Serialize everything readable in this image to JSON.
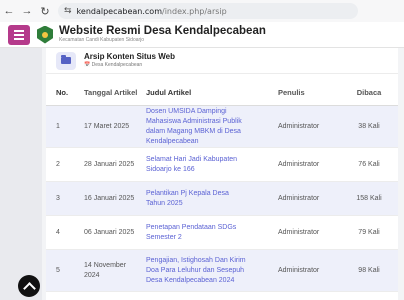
{
  "browser": {
    "back_icon": "←",
    "forward_icon": "→",
    "reload_icon": "↻",
    "tune_icon": "⇆",
    "url_host": "kendalpecabean.com",
    "url_path": "/index.php/arsip"
  },
  "site": {
    "title": "Website Resmi Desa Kendalpecabean",
    "subtitle": "Kecamatan Candi  Kabupaten Sidoarjo"
  },
  "card": {
    "title": "Arsip Konten Situs Web",
    "subtitle": "📅 Desa Kendalpecabean"
  },
  "table": {
    "headers": {
      "no": "No.",
      "date": "Tanggal Artikel",
      "title": "Judul Artikel",
      "author": "Penulis",
      "reads": "Dibaca"
    },
    "rows": [
      {
        "no": "1",
        "date": "17 Maret 2025",
        "title": "Dosen UMSIDA Dampingi Mahasiswa Administrasi Publik dalam Magang MBKM di Desa Kendalpecabean",
        "author": "Administrator",
        "reads": "38 Kali"
      },
      {
        "no": "2",
        "date": "28 Januari 2025",
        "title": "Selamat Hari Jadi Kabupaten Sidoarjo ke 166",
        "author": "Administrator",
        "reads": "76 Kali"
      },
      {
        "no": "3",
        "date": "16 Januari 2025",
        "title": "Pelantikan Pj Kepala Desa Tahun 2025",
        "author": "Administrator",
        "reads": "158 Kali"
      },
      {
        "no": "4",
        "date": "06 Januari 2025",
        "title": "Penetapan Pendataan SDGs Semester 2",
        "author": "Administrator",
        "reads": "79 Kali"
      },
      {
        "no": "5",
        "date": "14 November 2024",
        "title": "Pengajian, Istighosah Dan Kirim Doa Para Leluhur dan Sesepuh Desa Kendalpecabean 2024",
        "author": "Administrator",
        "reads": "98 Kali"
      }
    ]
  }
}
